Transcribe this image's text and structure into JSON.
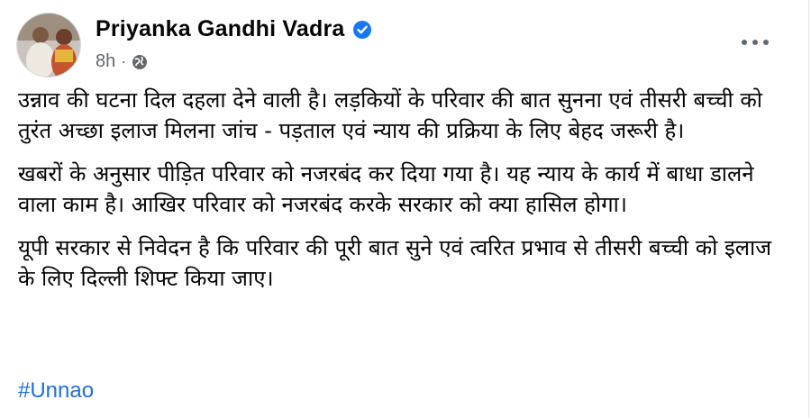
{
  "post": {
    "author": "Priyanka Gandhi Vadra",
    "verified_icon": "verified-badge-icon",
    "time": "8h",
    "separator": "·",
    "audience_icon": "globe-icon",
    "more_icon": "more-options-icon",
    "paragraphs": [
      "उन्नाव की घटना दिल दहला देने वाली है। लड़कियों के परिवार की बात सुनना एवं तीसरी बच्ची को तुरंत अच्छा इलाज मिलना जांच - पड़ताल एवं न्याय की प्रक्रिया के लिए बेहद जरूरी है।",
      "खबरों के अनुसार पीड़ित परिवार को नजरबंद कर दिया गया है। यह न्याय के कार्य में बाधा डालने वाला काम है। आखिर परिवार को नजरबंद करके सरकार को क्या हासिल होगा।",
      "यूपी सरकार से निवेदन है कि परिवार की पूरी बात सुने एवं त्वरित प्रभाव से तीसरी बच्ची को इलाज के लिए दिल्ली शिफ्ट किया जाए।"
    ],
    "hashtag": "#Unnao"
  },
  "colors": {
    "name": "#050505",
    "meta": "#65676b",
    "link": "#216fdb",
    "verified": "#1877f2"
  }
}
